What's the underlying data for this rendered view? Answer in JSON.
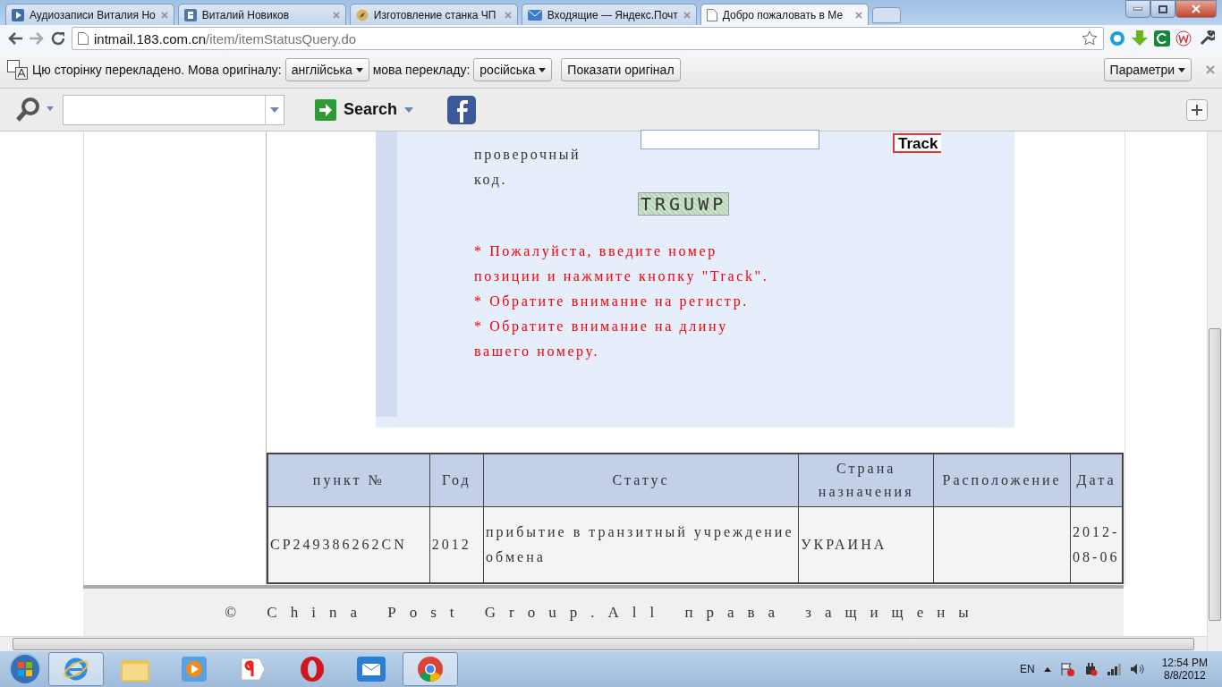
{
  "tabs": [
    {
      "title": "Аудиозаписи Виталия Но",
      "selected": false,
      "kind": "play"
    },
    {
      "title": "Виталий Новиков",
      "selected": false,
      "kind": "vk"
    },
    {
      "title": "Изготовление станка ЧП",
      "selected": false,
      "kind": "compass"
    },
    {
      "title": "Входящие — Яндекс.Почт",
      "selected": false,
      "kind": "mail"
    },
    {
      "title": "Добро пожаловать в Ме",
      "selected": true,
      "kind": "page"
    }
  ],
  "address": {
    "host": "intmail.183.com.cn",
    "path": "/item/itemStatusQuery.do"
  },
  "translate_bar": {
    "message": "Цю сторінку перекладено. Мова оригіналу:",
    "source_language": "англійська",
    "target_label": "мова перекладу:",
    "target_language": "російська",
    "show_original": "Показати оригінал",
    "options": "Параметри"
  },
  "toolbar": {
    "search_button": "Search"
  },
  "form": {
    "code_label": "проверочный код.",
    "captcha": "TRGUWP",
    "track_button": "Track",
    "notes": [
      "* Пожалуйста, введите номер позиции и нажмите кнопку \"Track\".",
      "* Обратите внимание на регистр.",
      "* Обратите внимание на длину вашего номеру."
    ]
  },
  "table": {
    "columns": [
      "пункт №",
      "Год",
      "Статус",
      "Страна назначения",
      "Расположение",
      "Дата"
    ],
    "rows": [
      [
        "CP249386262CN",
        "2012",
        "прибытие в транзитный учреждение обмена",
        "УКРАИНА",
        "",
        "2012-08-06"
      ]
    ]
  },
  "footer": "© China Post Group.All права защищены",
  "taskbar": {
    "language": "EN",
    "time": "12:54 PM",
    "date": "8/8/2012",
    "apps": [
      {
        "kind": "ie",
        "selected": true
      },
      {
        "kind": "folder",
        "selected": false
      },
      {
        "kind": "media",
        "selected": false
      },
      {
        "kind": "yandex",
        "selected": false
      },
      {
        "kind": "opera",
        "selected": false
      },
      {
        "kind": "mail",
        "selected": false
      },
      {
        "kind": "chrome",
        "selected": true
      }
    ]
  }
}
